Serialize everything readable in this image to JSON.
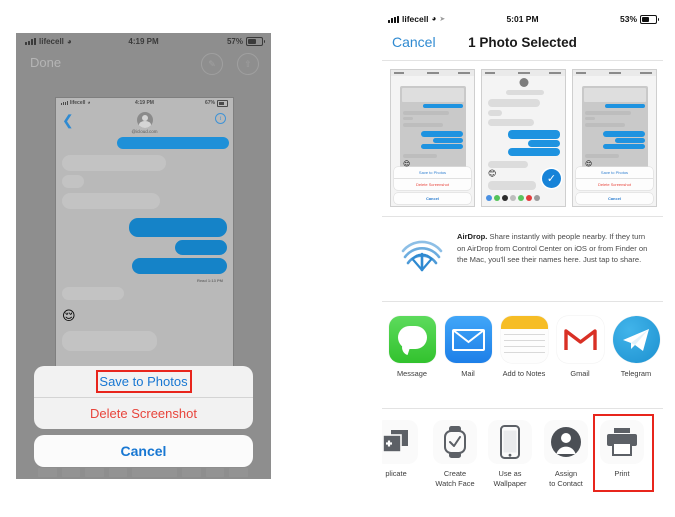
{
  "left_phone": {
    "status_bar": {
      "carrier": "lifecell",
      "time": "4:19 PM",
      "battery": "57%"
    },
    "nav": {
      "done_label": "Done",
      "markup_icon": "markup-icon",
      "share_icon": "share-icon"
    },
    "inner_screenshot": {
      "status_bar": {
        "carrier": "lifecell",
        "time": "4:19 PM",
        "battery": "67%"
      },
      "contact": "@icloud.com",
      "back_icon": "back-chevron-icon",
      "info_icon": "info-icon",
      "read_receipt": "Read 1:13 PM",
      "typing_dots": "•••",
      "emoji": "😌"
    },
    "action_sheet": {
      "save_label": "Save to Photos",
      "delete_label": "Delete Screenshot",
      "cancel_label": "Cancel"
    },
    "highlight_color": "#e8251c"
  },
  "right_phone": {
    "status_bar": {
      "carrier": "lifecell",
      "time": "5:01 PM",
      "battery": "53%"
    },
    "nav": {
      "cancel_label": "Cancel",
      "title": "1 Photo Selected"
    },
    "thumbnails": [
      {
        "name": "screenshot-with-action-sheet",
        "selected": false,
        "sheet": {
          "save": "Save to Photos",
          "delete": "Delete Screenshot",
          "cancel": "Cancel"
        }
      },
      {
        "name": "messages-conversation",
        "selected": true,
        "check_icon": "checkmark-icon"
      },
      {
        "name": "screenshot-with-action-sheet",
        "selected": false,
        "sheet": {
          "save": "Save to Photos",
          "delete": "Delete Screenshot",
          "cancel": "Cancel"
        }
      }
    ],
    "airdrop": {
      "icon": "airdrop-icon",
      "title": "AirDrop.",
      "text": " Share instantly with people nearby. If they turn on AirDrop from Control Center on iOS or from Finder on the Mac, you'll see their names here. Just tap to share."
    },
    "apps": [
      {
        "label": "Message",
        "icon": "messages-icon",
        "color": "#3ec74d"
      },
      {
        "label": "Mail",
        "icon": "mail-icon",
        "color": "#2a8fef"
      },
      {
        "label": "Add to Notes",
        "icon": "notes-icon",
        "color": "#f7ba22"
      },
      {
        "label": "Gmail",
        "icon": "gmail-icon",
        "color": "#d93025"
      },
      {
        "label": "Telegram",
        "icon": "telegram-icon",
        "color": "#2ca5e0"
      }
    ],
    "actions": [
      {
        "label": "Duplicate",
        "label_visible": "plicate",
        "icon": "duplicate-icon"
      },
      {
        "label": "Create Watch Face",
        "line1": "Create",
        "line2": "Watch Face",
        "icon": "watch-icon"
      },
      {
        "label": "Use as Wallpaper",
        "line1": "Use as",
        "line2": "Wallpaper",
        "icon": "phone-icon"
      },
      {
        "label": "Assign to Contact",
        "line1": "Assign",
        "line2": "to Contact",
        "icon": "contact-icon"
      },
      {
        "label": "Print",
        "line1": "Print",
        "line2": "",
        "icon": "printer-icon",
        "highlighted": true
      }
    ],
    "highlight_color": "#e8251c"
  }
}
